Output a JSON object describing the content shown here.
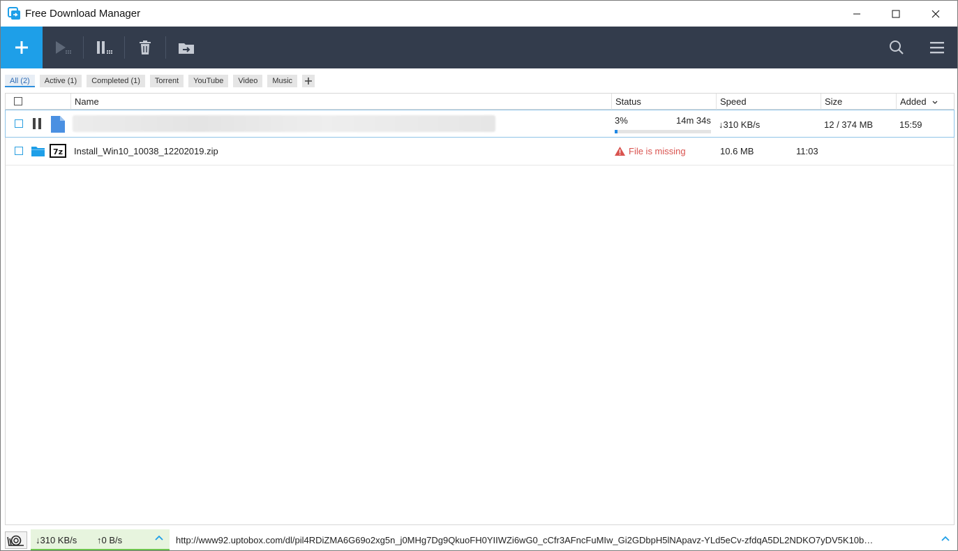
{
  "window": {
    "title": "Free Download Manager"
  },
  "toolbar": {
    "add": "add-icon",
    "resume": "play-icon",
    "pause": "pause-icon",
    "delete": "trash-icon",
    "move": "move-folder-icon",
    "search": "search-icon",
    "menu": "menu-icon"
  },
  "filters": [
    {
      "label": "All (2)",
      "active": true
    },
    {
      "label": "Active (1)"
    },
    {
      "label": "Completed (1)"
    },
    {
      "label": "Torrent"
    },
    {
      "label": "YouTube"
    },
    {
      "label": "Video"
    },
    {
      "label": "Music"
    }
  ],
  "columns": {
    "name": "Name",
    "status": "Status",
    "speed": "Speed",
    "size": "Size",
    "added": "Added"
  },
  "downloads": [
    {
      "name": "",
      "status_percent": "3%",
      "progress": 0.03,
      "eta": "14m 34s",
      "speed": "↓310 KB/s",
      "size": "12 / 374 MB",
      "added": "15:59"
    },
    {
      "name": "Install_Win10_10038_12202019.zip",
      "status": "File is missing",
      "speed": "10.6 MB",
      "added": "11:03"
    }
  ],
  "statusbar": {
    "down_speed": "↓310 KB/s",
    "up_speed": "↑0 B/s",
    "url": "http://www92.uptobox.com/dl/pil4RDiZMA6G69o2xg5n_j0MHg7Dg9QkuoFH0YIIWZi6wG0_cCfr3AFncFuMIw_Gi2GDbpH5lNApavz-YLd5eCv-zfdqA5DL2NDKO7yDV5K10b…"
  },
  "colors": {
    "toolbar_bg": "#333c4c",
    "accent": "#1e9fe8",
    "error": "#d9534f",
    "speed_bar": "#6ec44d"
  }
}
